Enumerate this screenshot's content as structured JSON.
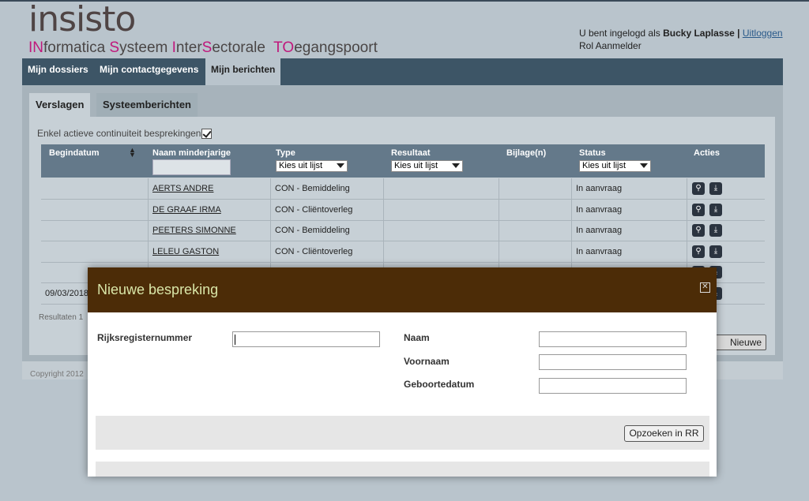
{
  "header": {
    "logo": "insisto",
    "tagline": [
      {
        "text": "IN",
        "hl": true
      },
      {
        "text": "formatica ",
        "hl": false
      },
      {
        "text": "S",
        "hl": true
      },
      {
        "text": "ysteem ",
        "hl": false
      },
      {
        "text": "I",
        "hl": true
      },
      {
        "text": "nter",
        "hl": false
      },
      {
        "text": "S",
        "hl": true
      },
      {
        "text": "ectorale  ",
        "hl": false
      },
      {
        "text": "TO",
        "hl": true
      },
      {
        "text": "egangspoort",
        "hl": false
      }
    ],
    "logged_in_prefix": "U bent ingelogd als",
    "user_name": "Bucky Laplasse",
    "separator": "|",
    "logout": "Uitloggen",
    "role": "Rol Aanmelder"
  },
  "nav": {
    "items": [
      "Mijn dossiers",
      "Mijn contactgegevens",
      "Mijn berichten"
    ]
  },
  "subtabs": [
    "Verslagen",
    "Systeemberichten"
  ],
  "filter": {
    "label": "Enkel actieve continuiteit besprekingen",
    "checked": true
  },
  "table": {
    "headers": {
      "begindatum": "Begindatum",
      "naam": "Naam minderjarige",
      "type": "Type",
      "resultaat": "Resultaat",
      "bijlage": "Bijlage(n)",
      "status": "Status",
      "acties": "Acties"
    },
    "select_placeholder": "Kies uit lijst",
    "rows": [
      {
        "date": "",
        "name": "AERTS ANDRE",
        "type": "CON - Bemiddeling",
        "result": "",
        "attach": "",
        "status": "In aanvraag"
      },
      {
        "date": "",
        "name": "DE GRAAF IRMA",
        "type": "CON - Cliëntoverleg",
        "result": "",
        "attach": "",
        "status": "In aanvraag"
      },
      {
        "date": "",
        "name": "PEETERS SIMONNE",
        "type": "CON - Bemiddeling",
        "result": "",
        "attach": "",
        "status": "In aanvraag"
      },
      {
        "date": "",
        "name": "LELEU GASTON",
        "type": "CON - Cliëntoverleg",
        "result": "",
        "attach": "",
        "status": "In aanvraag"
      },
      {
        "date": "",
        "name": "",
        "type": "",
        "result": "",
        "attach": "",
        "status": ""
      },
      {
        "date": "09/03/2018",
        "name": "",
        "type": "",
        "result": "",
        "attach": "",
        "status": ""
      }
    ]
  },
  "results_text": "Resultaten 1",
  "new_button": "Nieuwe bespreking",
  "copyright": "Copyright 2012",
  "modal": {
    "title": "Nieuwe bespreking",
    "labels": {
      "rrn": "Rijksregisternummer",
      "naam": "Naam",
      "voornaam": "Voornaam",
      "geboortedatum": "Geboortedatum"
    },
    "search_button": "Opzoeken in RR"
  }
}
